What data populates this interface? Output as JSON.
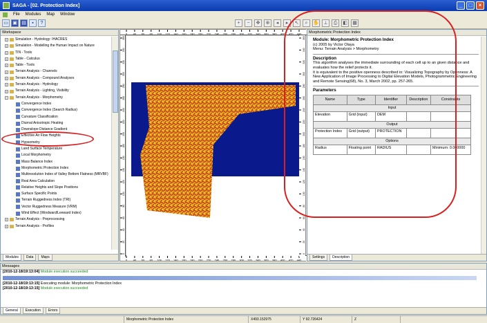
{
  "window": {
    "title": "SAGA - [02. Protection Index]"
  },
  "menu": [
    "File",
    "Modules",
    "Map",
    "Window"
  ],
  "left_panel": {
    "title": "Workspace",
    "tree": [
      {
        "label": "Simulation - Hydrology: IHACRES",
        "kind": "folder",
        "level": 1
      },
      {
        "label": "Simulation - Modelling the Human Impact on Nature",
        "kind": "folder",
        "level": 1
      },
      {
        "label": "TIN - Tools",
        "kind": "folder",
        "level": 1
      },
      {
        "label": "Table - Calculus",
        "kind": "folder",
        "level": 1
      },
      {
        "label": "Table - Tools",
        "kind": "folder",
        "level": 1
      },
      {
        "label": "Terrain Analysis - Channels",
        "kind": "folder",
        "level": 1
      },
      {
        "label": "Terrain Analysis - Compound Analyses",
        "kind": "folder",
        "level": 1
      },
      {
        "label": "Terrain Analysis - Hydrology",
        "kind": "folder",
        "level": 1
      },
      {
        "label": "Terrain Analysis - Lighting, Visibility",
        "kind": "folder",
        "level": 1
      },
      {
        "label": "Terrain Analysis - Morphometry",
        "kind": "folder",
        "level": 1,
        "open": true
      },
      {
        "label": "Convergence Index",
        "kind": "module",
        "level": 2
      },
      {
        "label": "Convergence Index (Search Radius)",
        "kind": "module",
        "level": 2
      },
      {
        "label": "Curvature Classification",
        "kind": "module",
        "level": 2
      },
      {
        "label": "Diurnal Anisotropic Heating",
        "kind": "module",
        "level": 2
      },
      {
        "label": "Downslope Distance Gradient",
        "kind": "module",
        "level": 2
      },
      {
        "label": "Effective Air Flow Heights",
        "kind": "module",
        "level": 2
      },
      {
        "label": "Hypsometry",
        "kind": "module",
        "level": 2
      },
      {
        "label": "Land Surface Temperature",
        "kind": "module",
        "level": 2
      },
      {
        "label": "Local Morphometry",
        "kind": "module",
        "level": 2
      },
      {
        "label": "Mass Balance Index",
        "kind": "module",
        "level": 2
      },
      {
        "label": "Morphometric Protection Index",
        "kind": "module",
        "level": 2
      },
      {
        "label": "Multiresolution Index of Valley Bottom Flatness (MRVBF)",
        "kind": "module",
        "level": 2
      },
      {
        "label": "Real Area Calculation",
        "kind": "module",
        "level": 2
      },
      {
        "label": "Relative Heights and Slope Positions",
        "kind": "module",
        "level": 2
      },
      {
        "label": "Surface Specific Points",
        "kind": "module",
        "level": 2
      },
      {
        "label": "Terrain Ruggedness Index (TRI)",
        "kind": "module",
        "level": 2
      },
      {
        "label": "Vector Ruggedness Measure (VRM)",
        "kind": "module",
        "level": 2
      },
      {
        "label": "Wind Effect (Windward/Leeward Index)",
        "kind": "module",
        "level": 2
      },
      {
        "label": "Terrain Analysis - Preprocessing",
        "kind": "folder",
        "level": 1
      },
      {
        "label": "Terrain Analysis - Profiles",
        "kind": "folder",
        "level": 1
      }
    ],
    "tabs": [
      "Modules",
      "Data",
      "Maps"
    ]
  },
  "map": {
    "x_ticks": [
      "0",
      "40",
      "60",
      "80",
      "100",
      "120",
      "140",
      "160",
      "180",
      "200",
      "220",
      "240",
      "260",
      "280",
      "300",
      "320",
      "340",
      "360",
      "380",
      "400",
      "420",
      "440"
    ],
    "y_ticks": [
      "360",
      "340",
      "320",
      "300",
      "280",
      "260",
      "240",
      "220",
      "200",
      "180",
      "160",
      "140",
      "120",
      "100",
      "80",
      "60",
      "40",
      "20",
      "0"
    ],
    "colors": {
      "background": "#0a1a8c",
      "low": "#c22a0a",
      "high": "#f0e020"
    }
  },
  "right_panel": {
    "title": "Morphometric Protection Index",
    "module_line": "Module: Morphometric Protection Index",
    "copyright": "(c) 2005 by Victor Olaya",
    "menu_line": "Menu: Terrain Analysis > Morphometry",
    "description_heading": "Description",
    "description_text": "This algorithm analyses the immediate surrounding of each cell up to an given distance and evaluates how the relief protects it.",
    "description_text2": "It is equivalent to the positive openness described in: Visualizing Topography by Openness: A New Application of Image Processing to Digital Elevation Models, Photogrammetric Engineering and Remote Sensing(68), No. 3, March 2002, pp. 257-265.",
    "parameters_heading": "Parameters",
    "columns": [
      "Name",
      "Type",
      "Identifier",
      "Description",
      "Constraints"
    ],
    "groups": [
      {
        "label": "Input",
        "rows": [
          [
            "Elevation",
            "Grid (input)",
            "DEM",
            "",
            ""
          ]
        ]
      },
      {
        "label": "Output",
        "rows": [
          [
            "Protection Index",
            "Grid (output)",
            "PROTECTION",
            "",
            ""
          ]
        ]
      },
      {
        "label": "Options",
        "rows": [
          [
            "Radius",
            "Floating point",
            "RADIUS",
            "",
            "Minimum: 0.000000"
          ]
        ]
      }
    ],
    "tabs": [
      "Settings",
      "Description"
    ]
  },
  "messages": {
    "title": "Messages",
    "lines": [
      {
        "time": "[2010-12-18/19:13:04]",
        "text": "Module execution succeeded"
      },
      {
        "time": "[2010-12-18/19:13:15]",
        "text": "Executing module: Morphometric Protection Index"
      },
      {
        "time": "[2010-12-18/19:13:15]",
        "text": "Module execution succeeded"
      }
    ],
    "tabs": [
      "General",
      "Execution",
      "Errors"
    ]
  },
  "status": {
    "module": "Morphometric Protection Index",
    "x": "X493.152975",
    "y": "Y 92.726424",
    "z": "Z"
  }
}
